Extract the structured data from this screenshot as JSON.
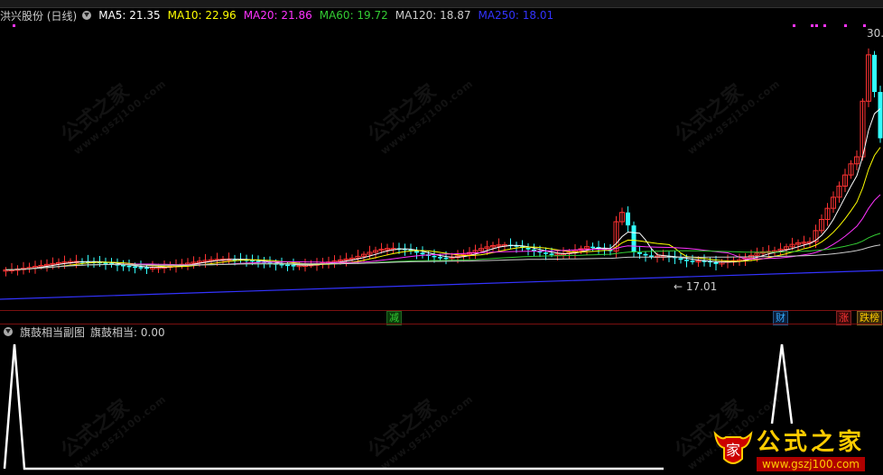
{
  "stock_name": "洪兴股份",
  "period": "(日线)",
  "ma": [
    {
      "label": "MA5: 21.35",
      "color": "#ffffff"
    },
    {
      "label": "MA10: 22.96",
      "color": "#ffff00"
    },
    {
      "label": "MA20: 21.86",
      "color": "#ff33ff"
    },
    {
      "label": "MA60: 19.72",
      "color": "#33cc33"
    },
    {
      "label": "MA120: 18.87",
      "color": "#cccccc"
    },
    {
      "label": "MA250: 18.01",
      "color": "#3333ff"
    }
  ],
  "price_labels": {
    "low": "← 17.01",
    "high": "30."
  },
  "event_tags": [
    {
      "text": "减",
      "color": "#33cc33"
    },
    {
      "text": "财",
      "color": "#33aaff"
    },
    {
      "text": "涨",
      "color": "#ff3333"
    },
    {
      "text": "跌榜",
      "color": "#ffcc00"
    }
  ],
  "sub_indicator": {
    "name": "旗鼓相当副图",
    "value_label": "旗鼓相当: 0.00"
  },
  "watermark": {
    "text": "公式之家",
    "url": "www.gszj100.com"
  },
  "logo": {
    "text": "公式之家",
    "url": "www.gszj100.com"
  },
  "colors": {
    "up": "#ff3333",
    "down": "#33ffff"
  }
}
